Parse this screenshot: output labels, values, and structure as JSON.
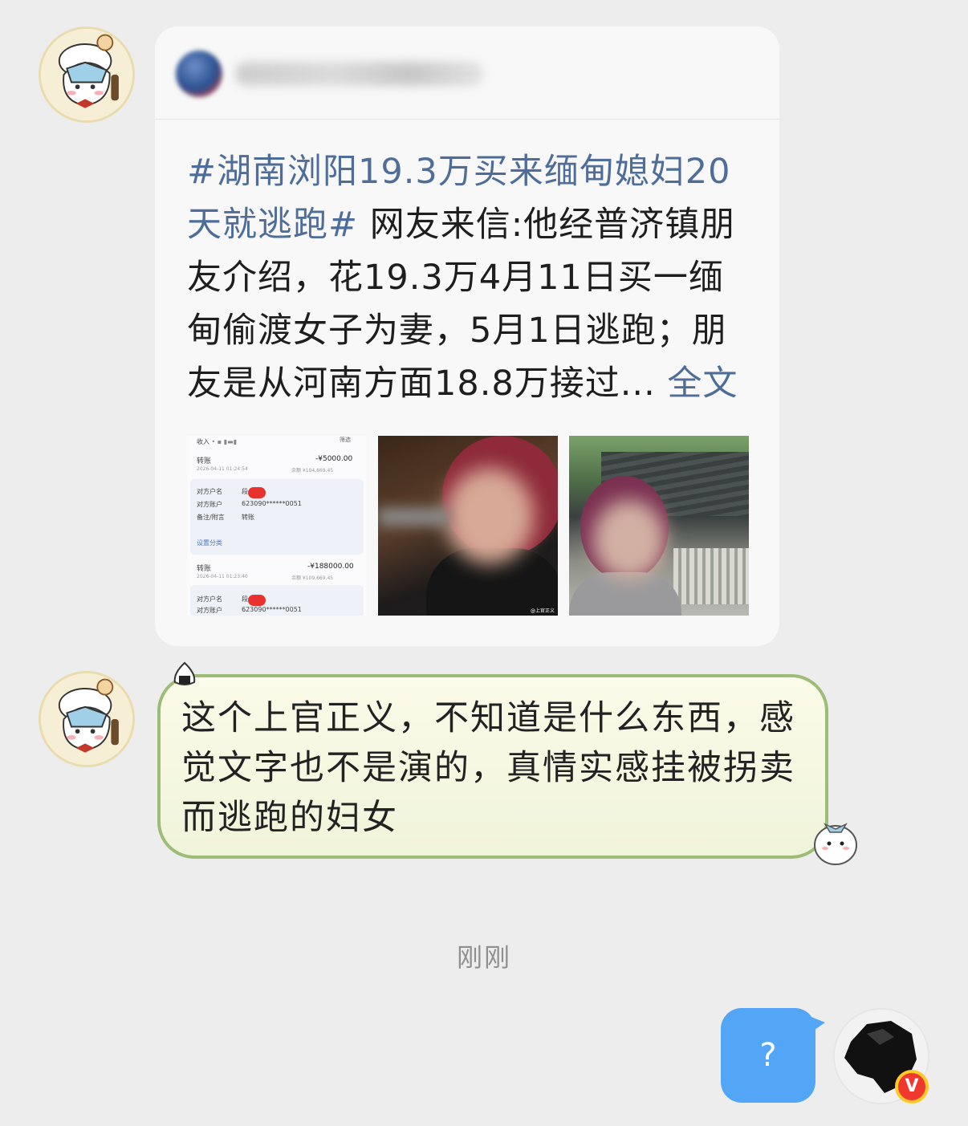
{
  "shared_post": {
    "hashtag": "#湖南浏阳19.3万买来缅甸媳妇20天就逃跑#",
    "body": " 网友来信:他经普济镇朋友介绍，花19.3万4月11日买一缅甸偷渡女子为妻，5月1日逃跑；朋友是从河南方面18.8万接过...",
    "more_link": " 全文",
    "images": [
      {
        "type": "payment-screenshot",
        "rows": {
          "income_label": "收入",
          "filter_label": "筛选",
          "transfer_label": "转账",
          "amount_1": "-¥5000.00",
          "time_1": "2026-04-11 01:24:54",
          "balance_1": "余额  ¥104,669.45",
          "payee_name_label": "对方户名",
          "payee_acct_label": "对方账户",
          "account_masked": "623090******0051",
          "remark_label": "备注/附言",
          "remark_value": "转账",
          "category_label": "设置分类",
          "amount_2": "-¥188000.00",
          "time_2": "2026-04-11 01:23:40",
          "balance_2": "余额  ¥109,669.45",
          "name_prefix": "段"
        }
      },
      {
        "type": "photo",
        "watermark": "@上官正义"
      },
      {
        "type": "photo"
      }
    ]
  },
  "reply_message": {
    "text": "这个上官正义，不知道是什么东西，感觉文字也不是演的，真情实感挂被拐卖而逃跑的妇女"
  },
  "timestamp": "刚刚",
  "my_message": {
    "text": "?"
  },
  "colors": {
    "background": "#ededed",
    "hashtag_link": "#4e6e99",
    "reply_border": "#9cbc78",
    "my_bubble": "#53a6f6",
    "verified_badge": "#f0382e"
  },
  "icons": {
    "verified_badge_letter": "V"
  }
}
